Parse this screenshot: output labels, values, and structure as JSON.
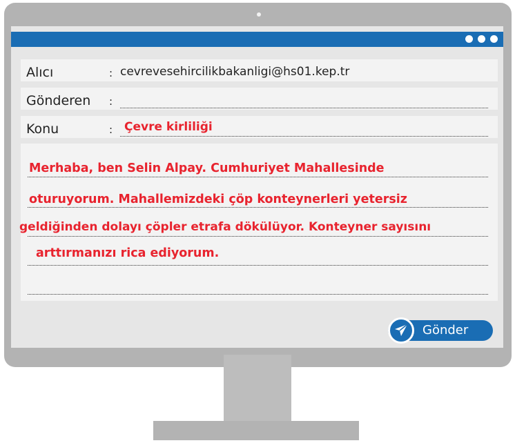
{
  "email": {
    "to_label": "Alıcı",
    "to_value": "cevrevesehircilikbakanligi@hs01.kep.tr",
    "from_label": "Gönderen",
    "from_value": "",
    "subject_label": "Konu",
    "subject_value": "Çevre kirliliği",
    "colon": ":",
    "message_lines": [
      "Merhaba, ben Selin Alpay. Cumhuriyet Mahallesinde",
      "oturuyorum. Mahallemizdeki çöp konteynerleri yetersiz",
      "geldiğinden dolayı çöpler etrafa dökülüyor. Konteyner sayısını",
      "arttırmanızı rica ediyorum."
    ],
    "send_label": "Gönder"
  },
  "icons": {
    "window_menu": "more-dots-icon",
    "send": "paper-plane-icon"
  },
  "colors": {
    "accent": "#1a6db4",
    "highlight_text": "#e8232e",
    "frame": "#b3b3b3"
  }
}
